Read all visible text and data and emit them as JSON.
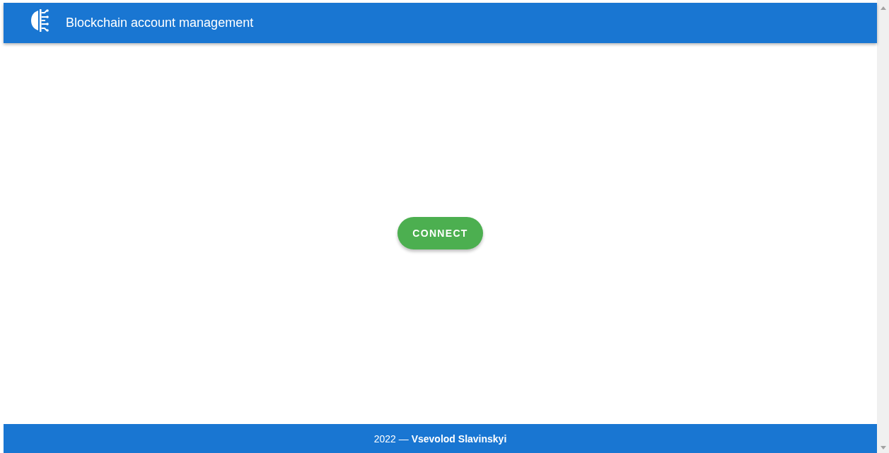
{
  "app_bar": {
    "title": "Blockchain account management"
  },
  "main": {
    "connect_button": "CONNECT"
  },
  "footer": {
    "text": "2022 — **Vsevolod Slavinskyi**"
  }
}
